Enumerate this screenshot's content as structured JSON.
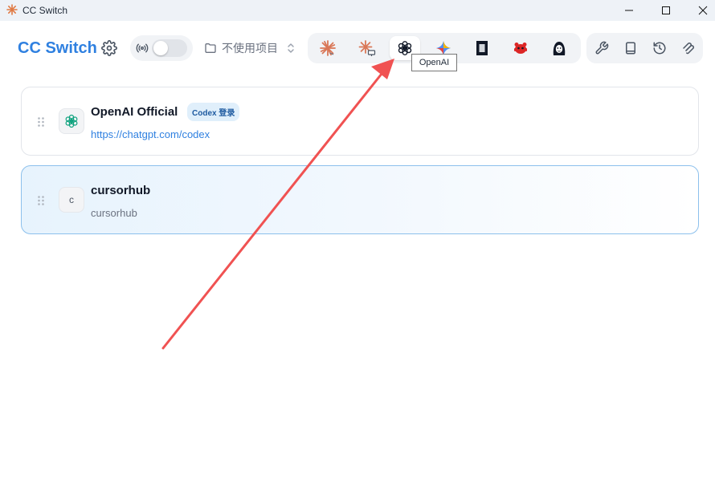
{
  "window": {
    "title": "CC Switch"
  },
  "header": {
    "brand": "CC Switch",
    "project_label": "不使用项目"
  },
  "apps": [
    {
      "name": "claude-code-icon",
      "active": false
    },
    {
      "name": "claude-desktop-icon",
      "active": false
    },
    {
      "name": "openai-icon",
      "active": true
    },
    {
      "name": "gemini-icon",
      "active": false
    },
    {
      "name": "opencode-icon",
      "active": false
    },
    {
      "name": "red-bot-icon",
      "active": false
    },
    {
      "name": "qwen-icon",
      "active": false
    }
  ],
  "tooltip": {
    "text": "OpenAI"
  },
  "providers": [
    {
      "name": "OpenAI Official",
      "badge": "Codex 登录",
      "link": "https://chatgpt.com/codex",
      "logo": "openai-icon",
      "active": false
    },
    {
      "name": "cursorhub",
      "badge": "",
      "subtitle": "cursorhub",
      "logo_letter": "c",
      "active": true
    }
  ],
  "colors": {
    "accent": "#2f80e0",
    "annotation_arrow": "#f05252",
    "claude": "#d97757"
  }
}
